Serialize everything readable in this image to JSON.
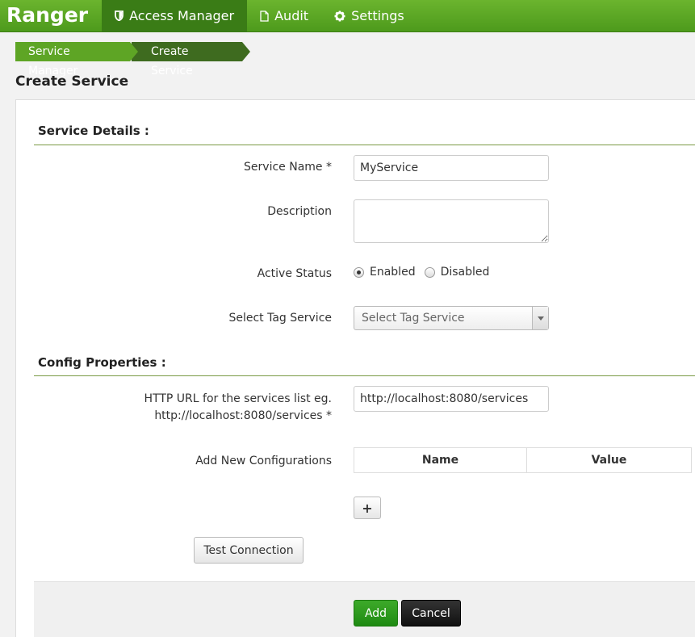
{
  "navbar": {
    "brand": "Ranger",
    "items": [
      {
        "label": "Access Manager",
        "icon": "shield-icon",
        "active": true
      },
      {
        "label": "Audit",
        "icon": "file-icon",
        "active": false
      },
      {
        "label": "Settings",
        "icon": "gear-icon",
        "active": false
      }
    ]
  },
  "breadcrumb": [
    "Service Manager",
    "Create Service"
  ],
  "page_title": "Create Service",
  "service_details": {
    "title": "Service Details :",
    "service_name_label": "Service Name *",
    "service_name_value": "MyService",
    "description_label": "Description",
    "description_value": "",
    "active_status_label": "Active Status",
    "status_options": [
      "Enabled",
      "Disabled"
    ],
    "status_selected": "Enabled",
    "tag_service_label": "Select Tag Service",
    "tag_service_placeholder": "Select Tag Service"
  },
  "config": {
    "title": "Config Properties :",
    "url_label_line1": "HTTP URL for the services list eg.",
    "url_label_line2": "http://localhost:8080/services *",
    "url_value": "http://localhost:8080/services",
    "add_configs_label": "Add New Configurations",
    "columns": [
      "Name",
      "Value"
    ],
    "add_row_label": "+",
    "test_connection_label": "Test Connection"
  },
  "footer": {
    "add_label": "Add",
    "cancel_label": "Cancel"
  },
  "colors": {
    "navbar": "#5ba523",
    "nav_active": "#3a7c16",
    "add_button": "#2a9a1c",
    "cancel_button": "#222222"
  }
}
